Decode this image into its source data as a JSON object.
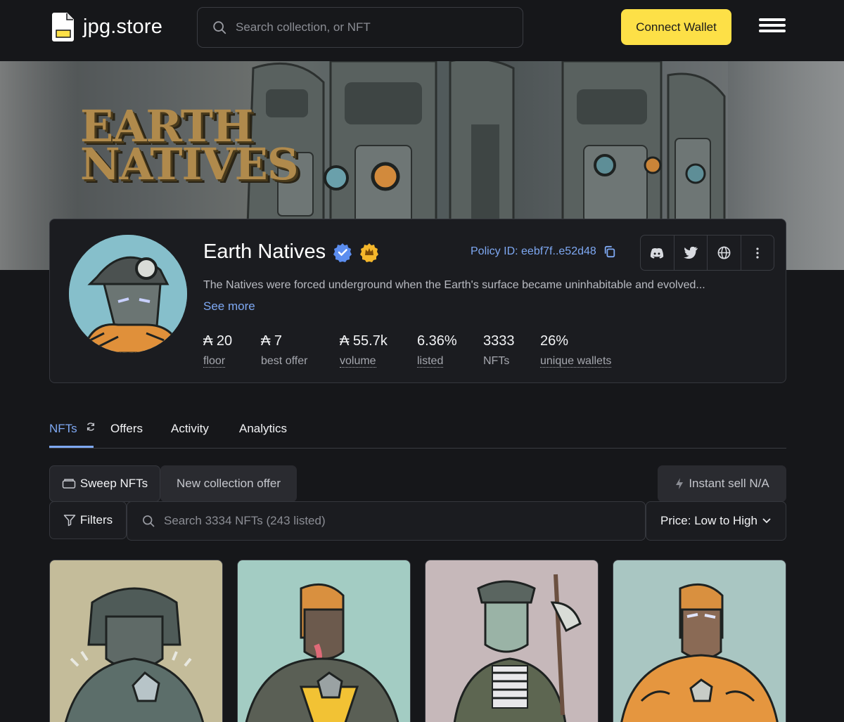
{
  "header": {
    "logo_text": "jpg.store",
    "search_placeholder": "Search collection, or NFT",
    "connect_label": "Connect Wallet"
  },
  "banner": {
    "title_line1": "EARTH",
    "title_line2": "NATIVES"
  },
  "collection": {
    "name": "Earth Natives",
    "policy_label": "Policy ID: eebf7f..e52d48",
    "description": "The Natives were forced underground when the Earth's surface became uninhabitable and evolved...",
    "see_more": "See more",
    "socials": [
      "discord-icon",
      "twitter-icon",
      "globe-icon",
      "more-icon"
    ]
  },
  "stats": [
    {
      "value": "₳ 20",
      "label": "floor"
    },
    {
      "value": "₳ 7",
      "label": "best offer"
    },
    {
      "value": "₳ 55.7k",
      "label": "volume"
    },
    {
      "value": "6.36%",
      "label": "listed"
    },
    {
      "value": "3333",
      "label": "NFTs"
    },
    {
      "value": "26%",
      "label": "unique wallets"
    }
  ],
  "tabs": [
    {
      "label": "NFTs",
      "active": true
    },
    {
      "label": "Offers"
    },
    {
      "label": "Activity"
    },
    {
      "label": "Analytics"
    }
  ],
  "actions": {
    "sweep": "Sweep NFTs",
    "collection_offer": "New collection offer",
    "instant_sell": "Instant sell N/A",
    "filters": "Filters",
    "search_placeholder": "Search 3334 NFTs (243 listed)",
    "sort": "Price: Low to High"
  },
  "colors": {
    "accent_yellow": "#fde047",
    "link_blue": "#7ea8f2",
    "background": "#16171a"
  }
}
